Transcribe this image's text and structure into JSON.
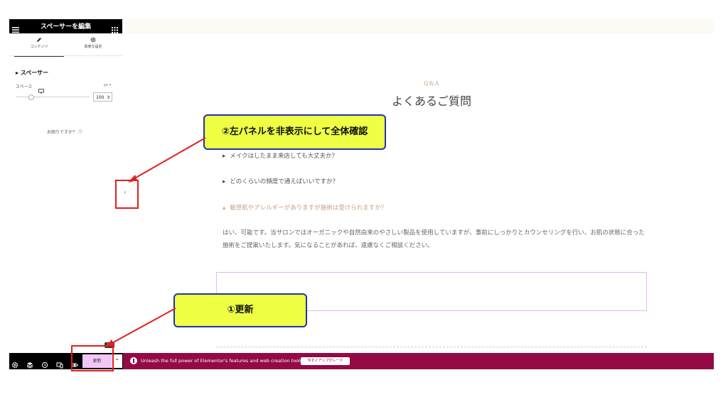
{
  "panel": {
    "title": "スペーサーを編集",
    "tabs": [
      {
        "label": "コンテンツ"
      },
      {
        "label": "高度な設定"
      }
    ],
    "section_title": "スペーサー",
    "space_label": "スペース",
    "unit": "px",
    "value": "100",
    "help_text": "お困りですか？"
  },
  "preview": {
    "small_heading": "Q&A",
    "title": "よくあるご質問",
    "questions": [
      "メイクはしたまま来店しても大丈夫か？",
      "どのくらいの頻度で通えばいいですか？",
      "敏感肌やアレルギーがありますが施術は受けられますか？"
    ],
    "answer": "はい、可能です。当サロンではオーガニックや自然由来のやさしい製品を使用していますが、事前にしっかりとカウンセリングを行い、お肌の状態に合った施術をご提案いたします。気になることがあれば、遠慮なくご相談ください。"
  },
  "annotations": {
    "collapse_note": "②左パネルを非表示にして全体確認",
    "update_note": "①更新"
  },
  "footer": {
    "update_label": "更新",
    "tooltip": "更新",
    "promo_text": "Unleash the full power of Elementor's features and web creation tools.",
    "upgrade_label": "今すぐアップグレード"
  },
  "colors": {
    "panel_header": "#000000",
    "update_button": "#f2c6f7",
    "promo_bar": "#930a44",
    "callout_fill": "#eeff44",
    "callout_border": "#2233aa",
    "annotation_red": "#e31e1e",
    "accent_gold": "#c5a387"
  }
}
